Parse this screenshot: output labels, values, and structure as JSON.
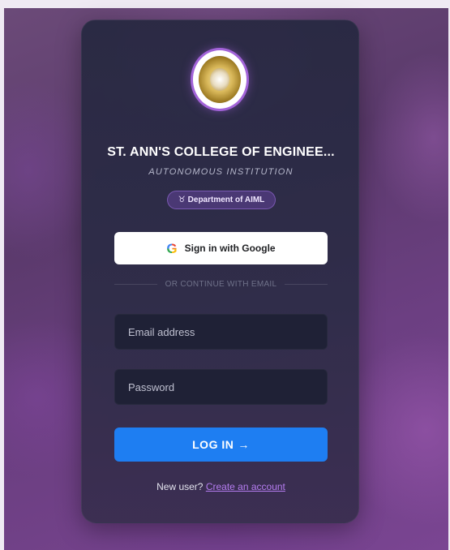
{
  "college": {
    "name": "ST. ANN'S COLLEGE OF ENGINEE...",
    "subtitle": "AUTONOMOUS INSTITUTION",
    "department": "Department of AIML"
  },
  "auth": {
    "google_label": "Sign in with Google",
    "divider_text": "OR CONTINUE WITH EMAIL",
    "email_placeholder": "Email address",
    "password_placeholder": "Password",
    "login_label": "LOG IN",
    "new_user_text": "New user?",
    "create_account_link": "Create an account"
  },
  "icons": {
    "department": "microscope-icon",
    "google": "google-icon",
    "arrow": "arrow-right-icon",
    "logo": "college-seal-logo"
  },
  "colors": {
    "primary": "#1e7ef2",
    "accent": "#b57cf0",
    "card": "#262840"
  }
}
